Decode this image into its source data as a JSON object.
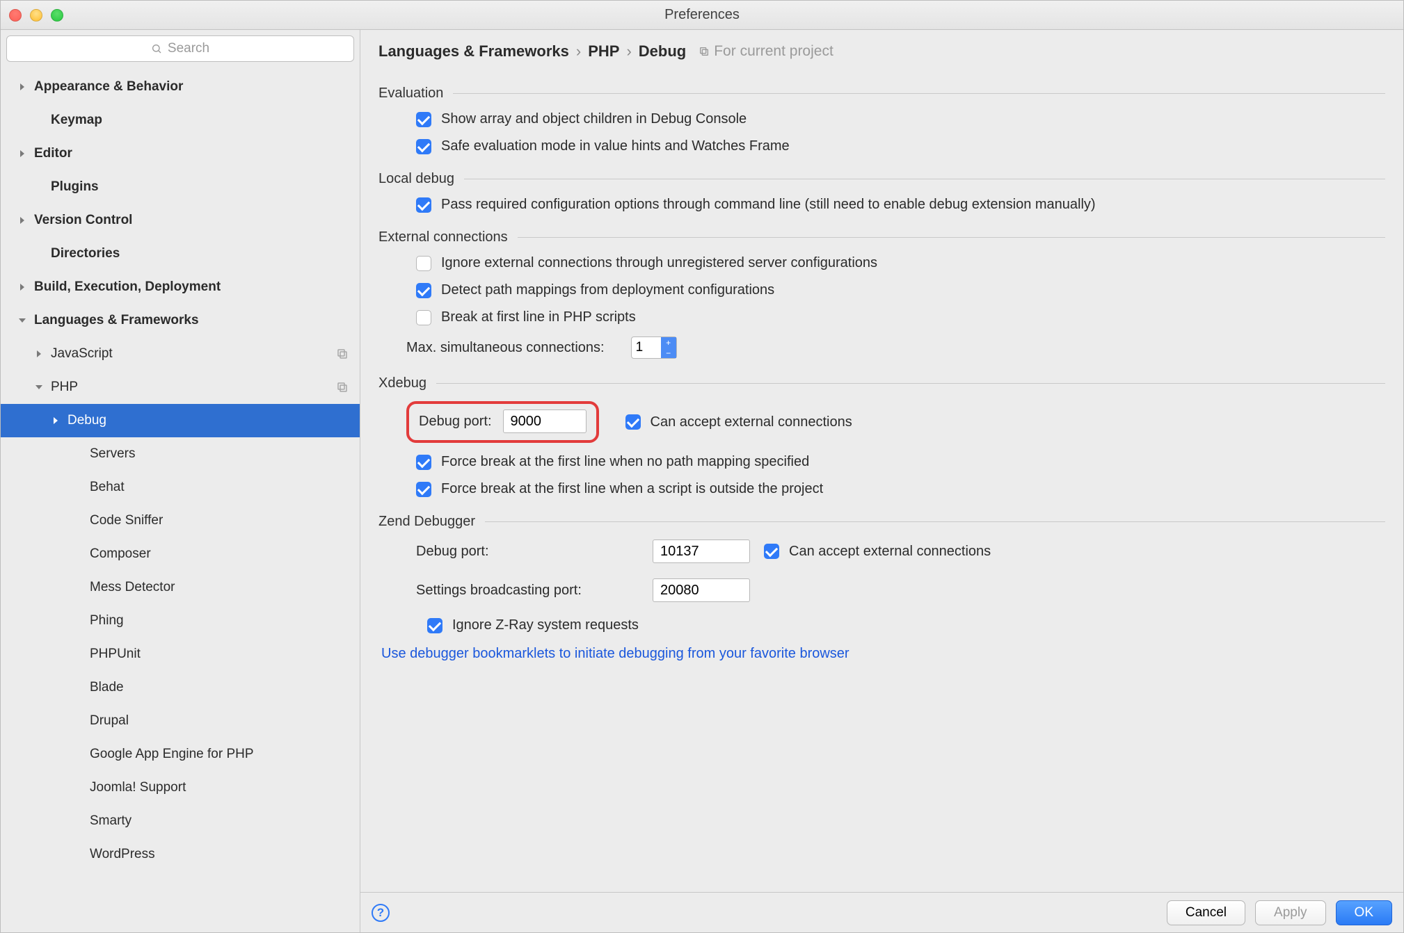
{
  "window": {
    "title": "Preferences"
  },
  "search": {
    "placeholder": "Search"
  },
  "sidebar": {
    "items": [
      {
        "label": "Appearance & Behavior",
        "indent": 24,
        "arrow": "right",
        "bold": true
      },
      {
        "label": "Keymap",
        "indent": 48,
        "arrow": "none",
        "bold": true
      },
      {
        "label": "Editor",
        "indent": 24,
        "arrow": "right",
        "bold": true
      },
      {
        "label": "Plugins",
        "indent": 48,
        "arrow": "none",
        "bold": true
      },
      {
        "label": "Version Control",
        "indent": 24,
        "arrow": "right",
        "bold": true
      },
      {
        "label": "Directories",
        "indent": 48,
        "arrow": "none",
        "bold": true
      },
      {
        "label": "Build, Execution, Deployment",
        "indent": 24,
        "arrow": "right",
        "bold": true
      },
      {
        "label": "Languages & Frameworks",
        "indent": 24,
        "arrow": "down",
        "bold": true
      },
      {
        "label": "JavaScript",
        "indent": 48,
        "arrow": "right",
        "bold": false,
        "badge": true
      },
      {
        "label": "PHP",
        "indent": 48,
        "arrow": "down",
        "bold": false,
        "badge": true
      },
      {
        "label": "Debug",
        "indent": 72,
        "arrow": "right",
        "bold": false,
        "selected": true
      },
      {
        "label": "Servers",
        "indent": 104,
        "arrow": "none",
        "bold": false
      },
      {
        "label": "Behat",
        "indent": 104,
        "arrow": "none",
        "bold": false
      },
      {
        "label": "Code Sniffer",
        "indent": 104,
        "arrow": "none",
        "bold": false
      },
      {
        "label": "Composer",
        "indent": 104,
        "arrow": "none",
        "bold": false
      },
      {
        "label": "Mess Detector",
        "indent": 104,
        "arrow": "none",
        "bold": false
      },
      {
        "label": "Phing",
        "indent": 104,
        "arrow": "none",
        "bold": false
      },
      {
        "label": "PHPUnit",
        "indent": 104,
        "arrow": "none",
        "bold": false
      },
      {
        "label": "Blade",
        "indent": 104,
        "arrow": "none",
        "bold": false
      },
      {
        "label": "Drupal",
        "indent": 104,
        "arrow": "none",
        "bold": false
      },
      {
        "label": "Google App Engine for PHP",
        "indent": 104,
        "arrow": "none",
        "bold": false
      },
      {
        "label": "Joomla! Support",
        "indent": 104,
        "arrow": "none",
        "bold": false
      },
      {
        "label": "Smarty",
        "indent": 104,
        "arrow": "none",
        "bold": false
      },
      {
        "label": "WordPress",
        "indent": 104,
        "arrow": "none",
        "bold": false
      }
    ]
  },
  "breadcrumb": {
    "parts": [
      "Languages & Frameworks",
      "PHP",
      "Debug"
    ],
    "scope": "For current project"
  },
  "sections": {
    "evaluation": {
      "title": "Evaluation",
      "opt1": "Show array and object children in Debug Console",
      "opt2": "Safe evaluation mode in value hints and Watches Frame"
    },
    "local": {
      "title": "Local debug",
      "opt1": "Pass required configuration options through command line (still need to enable debug extension manually)"
    },
    "external": {
      "title": "External connections",
      "opt1": "Ignore external connections through unregistered server configurations",
      "opt2": "Detect path mappings from deployment configurations",
      "opt3": "Break at first line in PHP scripts",
      "max_label": "Max. simultaneous connections:",
      "max_value": "1"
    },
    "xdebug": {
      "title": "Xdebug",
      "port_label": "Debug port:",
      "port_value": "9000",
      "accept": "Can accept external connections",
      "force1": "Force break at the first line when no path mapping specified",
      "force2": "Force break at the first line when a script is outside the project"
    },
    "zend": {
      "title": "Zend Debugger",
      "port_label": "Debug port:",
      "port_value": "10137",
      "accept": "Can accept external connections",
      "bcast_label": "Settings broadcasting port:",
      "bcast_value": "20080",
      "ignore": "Ignore Z-Ray system requests"
    }
  },
  "link": "Use debugger bookmarklets to initiate debugging from your favorite browser",
  "footer": {
    "cancel": "Cancel",
    "apply": "Apply",
    "ok": "OK"
  }
}
